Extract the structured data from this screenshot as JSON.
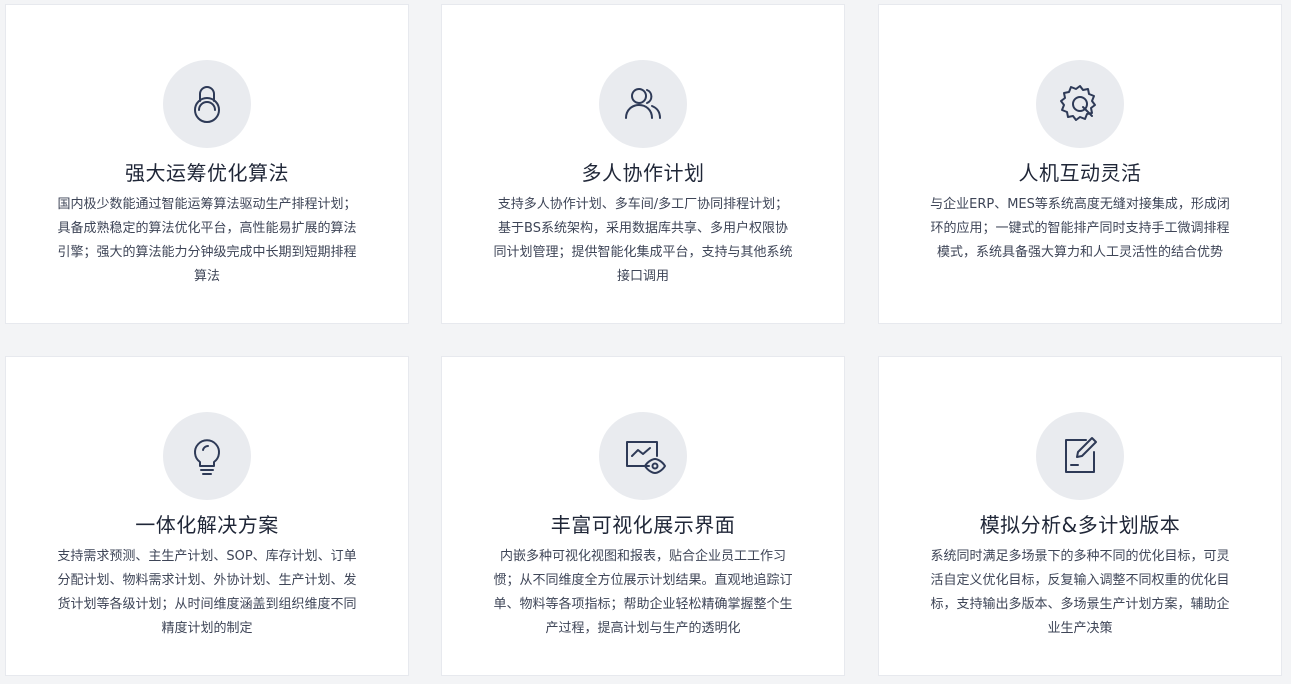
{
  "cards": [
    {
      "icon": "lock-icon",
      "title": "强大运筹优化算法",
      "desc": "国内极少数能通过智能运筹算法驱动生产排程计划；具备成熟稳定的算法优化平台，高性能易扩展的算法引擎；强大的算法能力分钟级完成中长期到短期排程算法"
    },
    {
      "icon": "users-icon",
      "title": "多人协作计划",
      "desc": "支持多人协作计划、多车间/多工厂协同排程计划；基于BS系统架构，采用数据库共享、多用户权限协同计划管理；提供智能化集成平台，支持与其他系统接口调用"
    },
    {
      "icon": "gear-icon",
      "title": "人机互动灵活",
      "desc": "与企业ERP、MES等系统高度无缝对接集成，形成闭环的应用；一键式的智能排产同时支持手工微调排程模式，系统具备强大算力和人工灵活性的结合优势"
    },
    {
      "icon": "lightbulb-icon",
      "title": "一体化解决方案",
      "desc": "支持需求预测、主生产计划、SOP、库存计划、订单分配计划、物料需求计划、外协计划、生产计划、发货计划等各级计划；从时间维度涵盖到组织维度不同精度计划的制定"
    },
    {
      "icon": "monitor-eye-icon",
      "title": "丰富可视化展示界面",
      "desc": "内嵌多种可视化视图和报表，贴合企业员工工作习惯；从不同维度全方位展示计划结果。直观地追踪订单、物料等各项指标；帮助企业轻松精确掌握整个生产过程，提高计划与生产的透明化"
    },
    {
      "icon": "edit-document-icon",
      "title": "模拟分析&多计划版本",
      "desc": "系统同时满足多场景下的多种不同的优化目标，可灵活自定义优化目标，反复输入调整不同权重的优化目标，支持输出多版本、多场景生产计划方案，辅助企业生产决策"
    }
  ]
}
